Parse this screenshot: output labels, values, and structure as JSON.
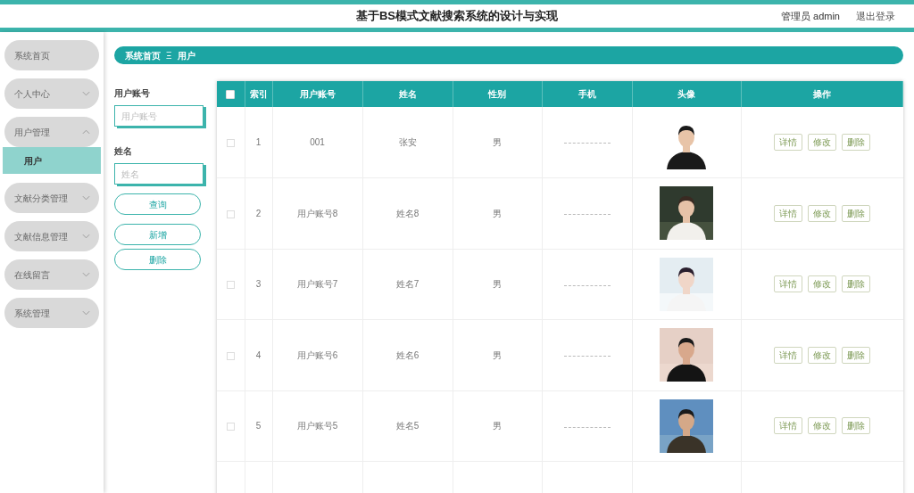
{
  "header": {
    "title": "基于BS模式文献搜索系统的设计与实现",
    "user": "管理员 admin",
    "logout": "退出登录"
  },
  "sidebar": {
    "items": [
      {
        "label": "系统首页"
      },
      {
        "label": "个人中心",
        "expanded": false
      },
      {
        "label": "用户管理",
        "expanded": true,
        "children": [
          {
            "label": "用户",
            "selected": true
          }
        ]
      },
      {
        "label": "文献分类管理",
        "expanded": false
      },
      {
        "label": "文献信息管理",
        "expanded": false
      },
      {
        "label": "在线留言",
        "expanded": false
      },
      {
        "label": "系统管理",
        "expanded": false
      }
    ]
  },
  "breadcrumb": [
    "系统首页",
    "用户"
  ],
  "breadcrumb_separator": "Ξ",
  "search": {
    "fields": [
      {
        "label": "用户账号",
        "placeholder": "用户账号"
      },
      {
        "label": "姓名",
        "placeholder": "姓名"
      }
    ],
    "buttons": [
      "查询",
      "新增",
      "删除"
    ]
  },
  "table": {
    "columns": [
      "索引",
      "用户账号",
      "姓名",
      "性别",
      "手机",
      "头像",
      "操作"
    ],
    "select_all_checked": false,
    "rows": [
      {
        "checked": false,
        "index": "1",
        "account": "001",
        "name": "张安",
        "gender": "男",
        "actions": [
          "详情",
          "修改",
          "删除"
        ]
      },
      {
        "checked": false,
        "index": "2",
        "account": "用户账号8",
        "name": "姓名8",
        "gender": "男",
        "actions": [
          "详情",
          "修改",
          "删除"
        ]
      },
      {
        "checked": false,
        "index": "3",
        "account": "用户账号7",
        "name": "姓名7",
        "gender": "男",
        "actions": [
          "详情",
          "修改",
          "删除"
        ]
      },
      {
        "checked": false,
        "index": "4",
        "account": "用户账号6",
        "name": "姓名6",
        "gender": "男",
        "actions": [
          "详情",
          "修改",
          "删除"
        ]
      },
      {
        "checked": false,
        "index": "5",
        "account": "用户账号5",
        "name": "姓名5",
        "gender": "男",
        "actions": [
          "详情",
          "修改",
          "删除"
        ]
      }
    ]
  }
}
